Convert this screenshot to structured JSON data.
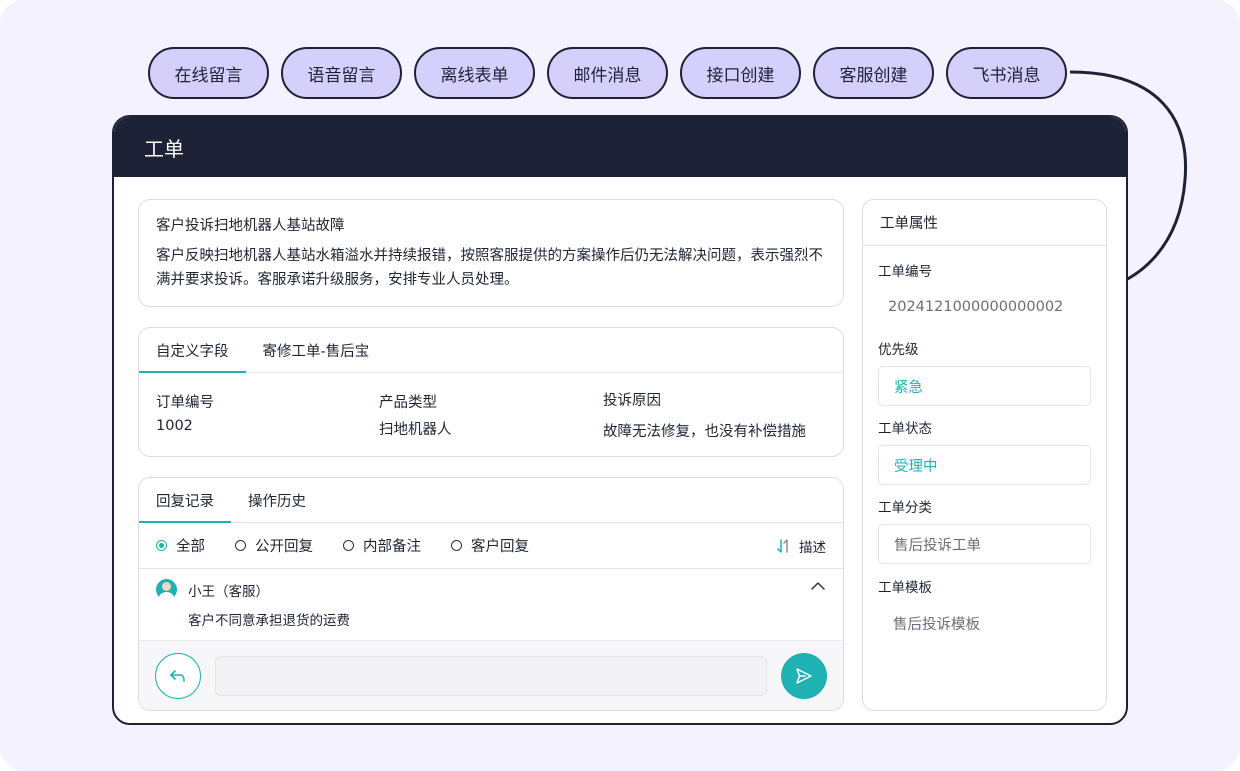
{
  "channels": [
    "在线留言",
    "语音留言",
    "离线表单",
    "邮件消息",
    "接口创建",
    "客服创建",
    "飞书消息"
  ],
  "window": {
    "title": "工单"
  },
  "summary": {
    "title": "客户投诉扫地机器人基站故障",
    "description": "客户反映扫地机器人基站水箱溢水并持续报错，按照客服提供的方案操作后仍无法解决问题，表示强烈不满并要求投诉。客服承诺升级服务，安排专业人员处理。"
  },
  "custom_fields": {
    "tabs": [
      "自定义字段",
      "寄修工单-售后宝"
    ],
    "active_tab": 0,
    "items": [
      {
        "label": "订单编号",
        "value": "1002"
      },
      {
        "label": "产品类型",
        "value": "扫地机器人"
      },
      {
        "label": "投诉原因",
        "value": "故障无法修复，也没有补偿措施"
      }
    ]
  },
  "replies": {
    "tabs": [
      "回复记录",
      "操作历史"
    ],
    "active_tab": 0,
    "filters": [
      "全部",
      "公开回复",
      "内部备注",
      "客户回复"
    ],
    "selected_filter": 0,
    "sort_label": "描述",
    "messages": [
      {
        "author": "小王（客服）",
        "text": "客户不同意承担退货的运费"
      }
    ],
    "composer": {
      "placeholder": ""
    }
  },
  "properties": {
    "title": "工单属性",
    "ticket_number_label": "工单编号",
    "ticket_number": "2024121000000000002",
    "priority_label": "优先级",
    "priority": "紧急",
    "status_label": "工单状态",
    "status": "受理中",
    "category_label": "工单分类",
    "category": "售后投诉工单",
    "template_label": "工单模板",
    "template": "售后投诉模板"
  },
  "colors": {
    "accent": "#1fb1b4",
    "header": "#1d2236",
    "pill": "#d5cffc",
    "background": "#f3f2fe"
  }
}
